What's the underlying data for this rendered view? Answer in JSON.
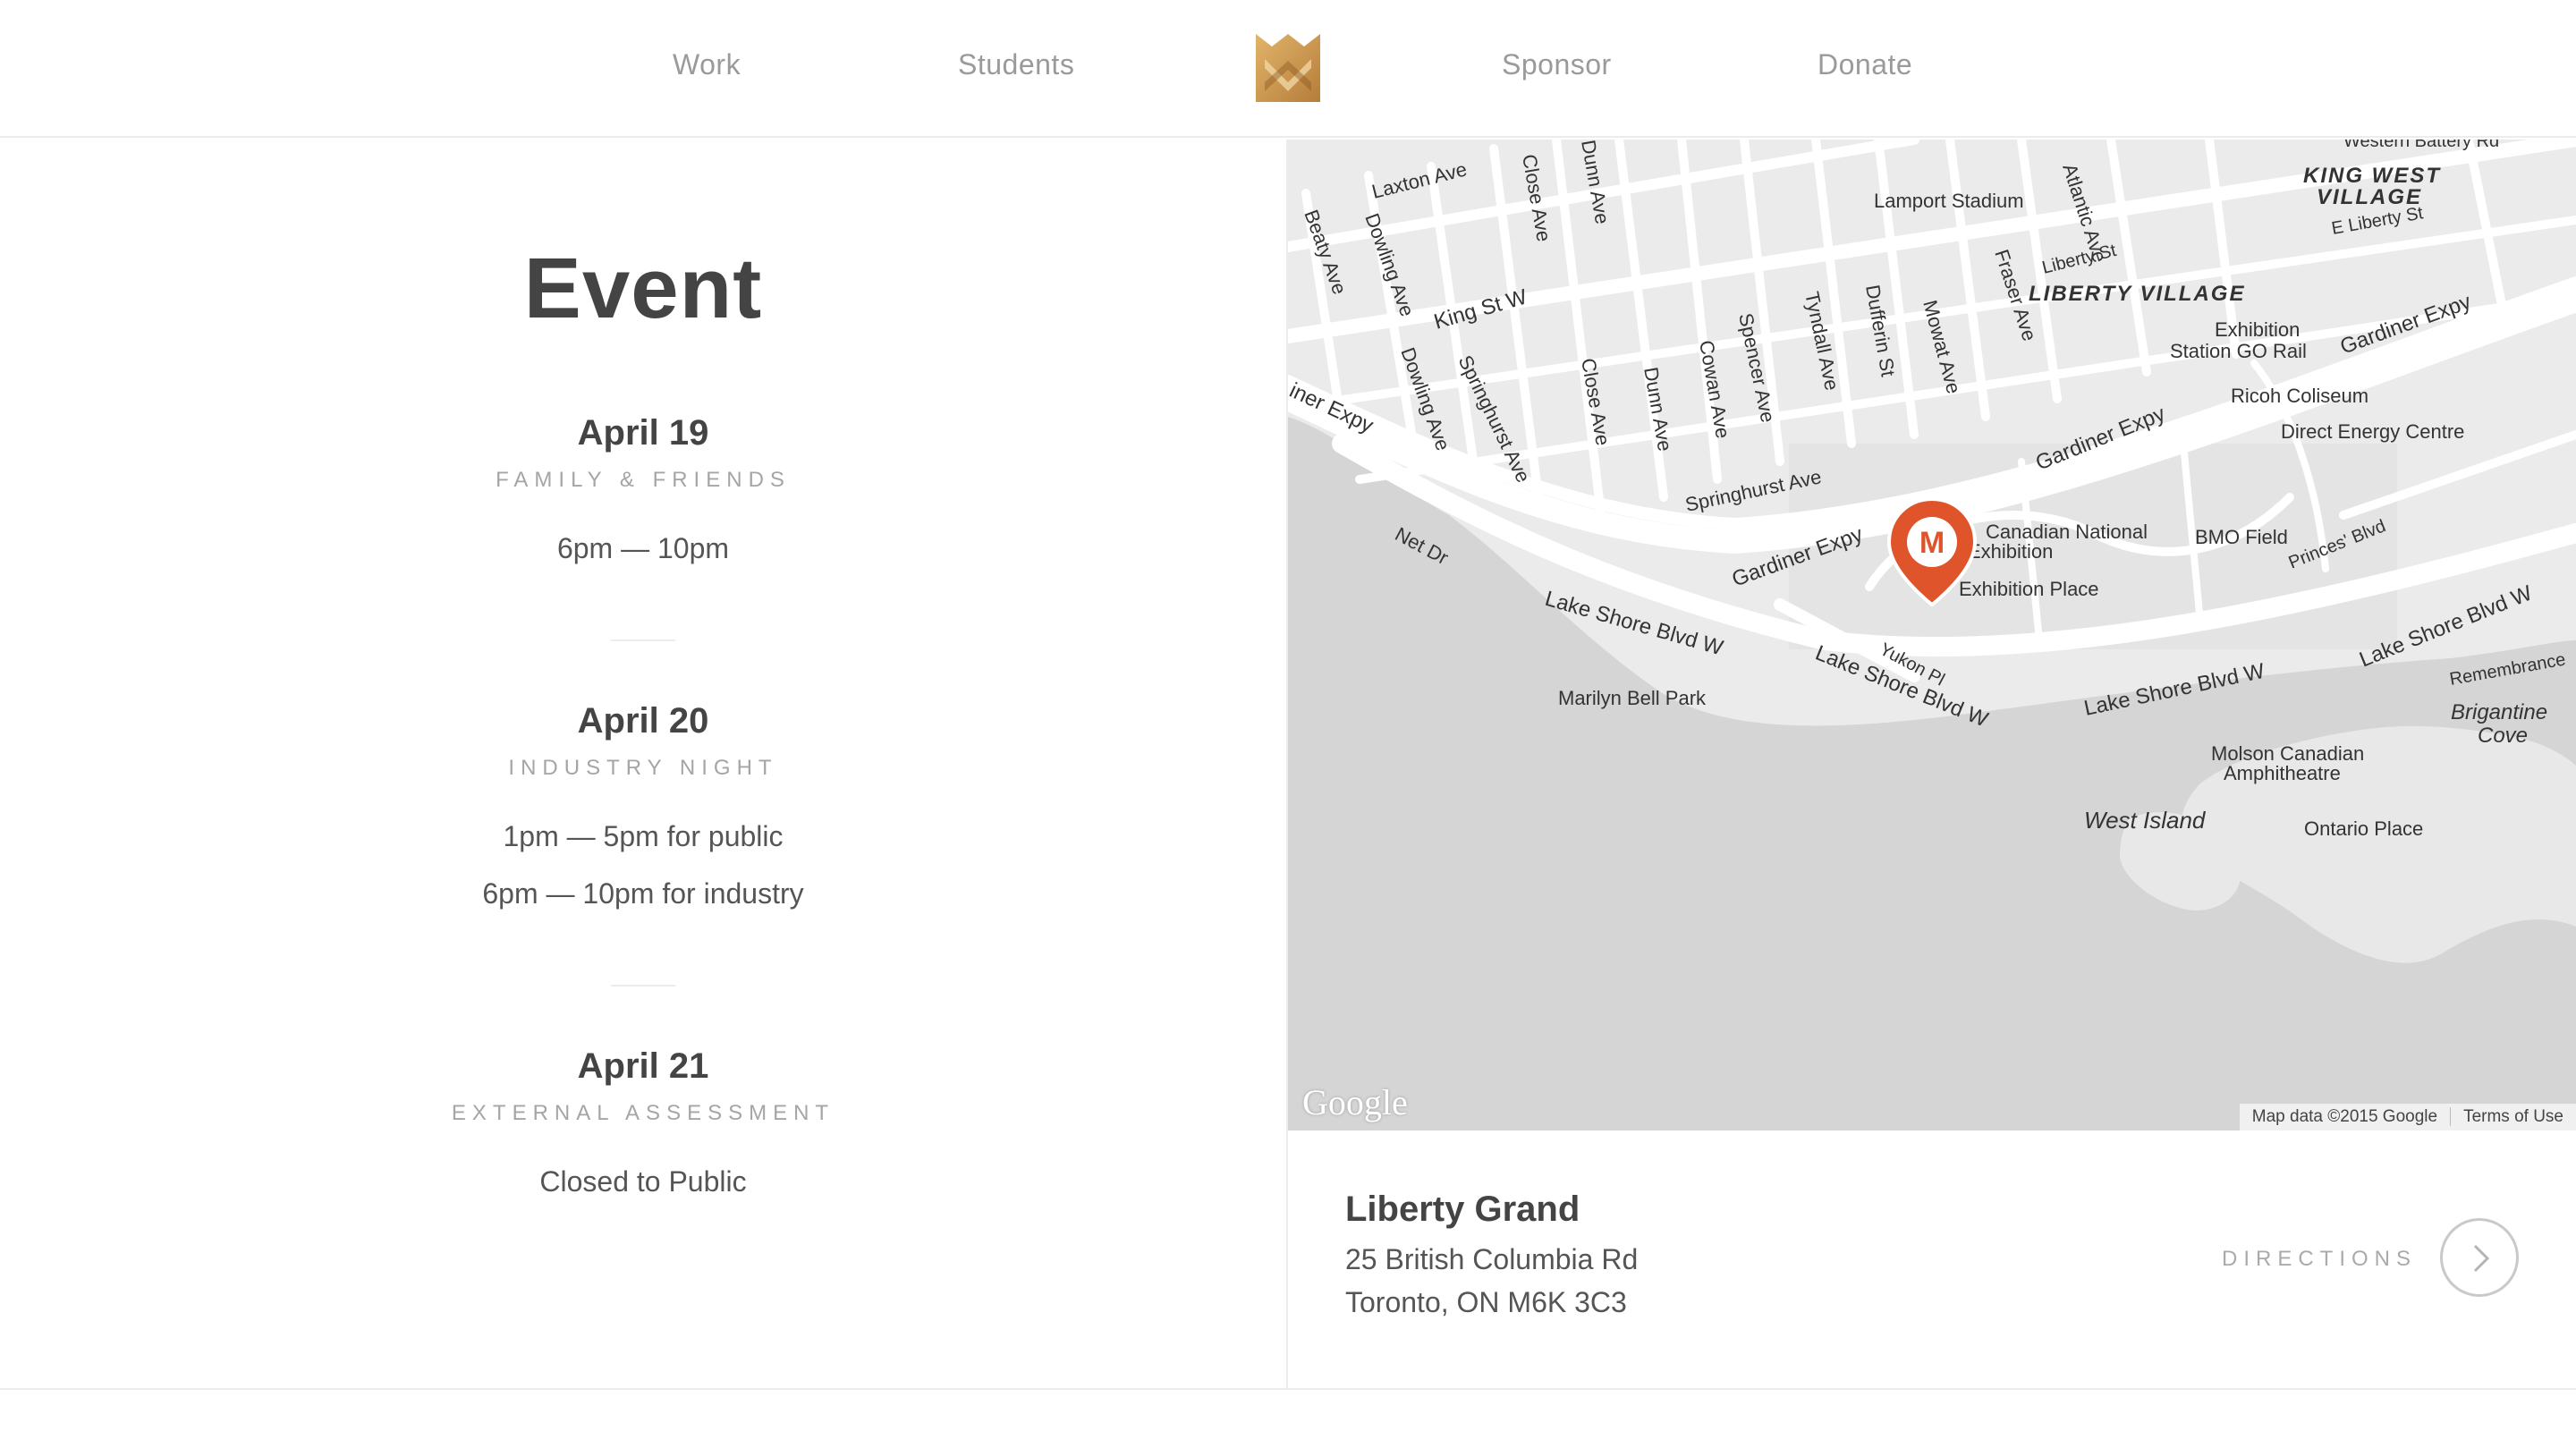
{
  "nav": {
    "items": [
      "Work",
      "Students",
      "Sponsor",
      "Donate"
    ],
    "logo_icon": "crown-m-logo-icon",
    "logo_color": "#c8934a"
  },
  "event": {
    "title": "Event",
    "days": [
      {
        "date": "April 19",
        "subtitle": "FAMILY & FRIENDS",
        "times": [
          "6pm — 10pm"
        ]
      },
      {
        "date": "April 20",
        "subtitle": "INDUSTRY NIGHT",
        "times": [
          "1pm — 5pm for public",
          "6pm — 10pm for industry"
        ]
      },
      {
        "date": "April 21",
        "subtitle": "EXTERNAL ASSESSMENT",
        "times": [
          "Closed to Public"
        ]
      }
    ]
  },
  "map": {
    "marker_letter": "M",
    "marker_color": "#e0542c",
    "google_logo": "Google",
    "attribution": "Map data ©2015 Google",
    "terms": "Terms of Use",
    "labels": {
      "western_battery": "Western Battery Rd",
      "king_west_village_1": "KING WEST",
      "king_west_village_2": "VILLAGE",
      "e_liberty": "E Liberty St",
      "lamport": "Lamport Stadium",
      "liberty_st": "Liberty St",
      "liberty_village": "LIBERTY VILLAGE",
      "exhibition_go_1": "Exhibition",
      "exhibition_go_2": "Station GO Rail",
      "gardiner_1": "Gardiner Expy",
      "gardiner_2": "Gardiner Expy",
      "gardiner_3": "Gardiner Expy",
      "gardiner_4": "iner Expy",
      "ricoh": "Ricoh Coliseum",
      "direct_energy": "Direct Energy Centre",
      "laxton": "Laxton Ave",
      "beaty": "Beaty Ave",
      "dowling_1": "Dowling Ave",
      "dowling_2": "Dowling Ave",
      "close_1": "Close Ave",
      "close_2": "Close Ave",
      "dunn_1": "Dunn Ave",
      "dunn_2": "Dunn Ave",
      "cowan": "Cowan Ave",
      "spencer": "Spencer Ave",
      "tyndall": "Tyndall Ave",
      "dufferin": "Dufferin St",
      "mowat": "Mowat Ave",
      "fraser": "Fraser Ave",
      "atlantic": "Atlantic Ave",
      "king_st": "King St W",
      "springhurst_1": "Springhurst Ave",
      "springhurst_2": "Springhurst Ave",
      "net_dr": "Net Dr",
      "cne_1": "Canadian National",
      "cne_2": "Exhibition",
      "exhibition_place": "Exhibition Place",
      "bmo": "BMO Field",
      "princes": "Princes' Blvd",
      "lakeshore_1": "Lake Shore Blvd W",
      "lakeshore_2": "Lake Shore Blvd W",
      "lakeshore_3": "Lake Shore Blvd W",
      "lakeshore_4": "Lake Shore Blvd W",
      "yukon": "Yukon Pl",
      "marilyn": "Marilyn Bell Park",
      "remembrance": "Remembrance",
      "brigantine_1": "Brigantine",
      "brigantine_2": "Cove",
      "molson_1": "Molson Canadian",
      "molson_2": "Amphitheatre",
      "west_island": "West Island",
      "ontario_place": "Ontario Place"
    }
  },
  "venue": {
    "name": "Liberty Grand",
    "address_line1": "25 British Columbia Rd",
    "address_line2": "Toronto, ON M6K 3C3",
    "directions_label": "DIRECTIONS"
  }
}
